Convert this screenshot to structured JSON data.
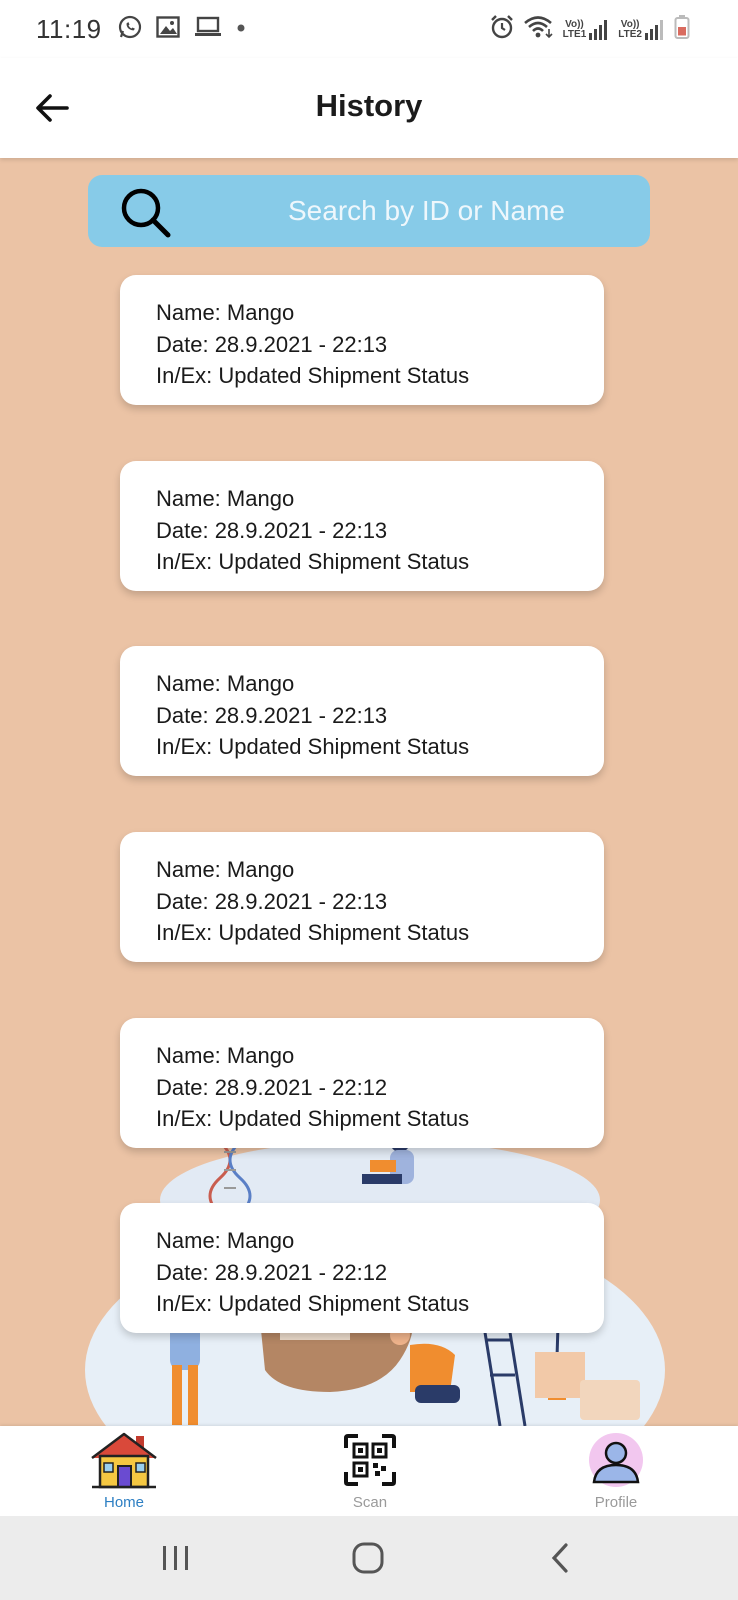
{
  "status_bar": {
    "time": "11:19",
    "left_icons": [
      "whatsapp-icon",
      "gallery-icon",
      "laptop-icon",
      "dot-icon"
    ],
    "right_icons": [
      "alarm-icon",
      "wifi-icon",
      "signal-lte1-icon",
      "signal-lte2-icon",
      "battery-icon"
    ],
    "lte1": "LTE1",
    "lte2": "LTE2",
    "volte": "Vo))"
  },
  "header": {
    "title": "History",
    "back_icon": "arrow-left-icon"
  },
  "search": {
    "placeholder": "Search by ID or Name",
    "value": "",
    "icon": "search-icon"
  },
  "history": [
    {
      "name": "Name: Mango",
      "date": "Date: 28.9.2021 - 22:13",
      "status": "In/Ex: Updated Shipment Status"
    },
    {
      "name": "Name: Mango",
      "date": "Date: 28.9.2021 - 22:13",
      "status": "In/Ex: Updated Shipment Status"
    },
    {
      "name": "Name: Mango",
      "date": "Date: 28.9.2021 - 22:13",
      "status": "In/Ex: Updated Shipment Status"
    },
    {
      "name": "Name: Mango",
      "date": "Date: 28.9.2021 - 22:13",
      "status": "In/Ex: Updated Shipment Status"
    },
    {
      "name": "Name: Mango",
      "date": "Date: 28.9.2021 - 22:12",
      "status": "In/Ex: Updated Shipment Status"
    },
    {
      "name": "Name: Mango",
      "date": "Date: 28.9.2021 - 22:12",
      "status": "In/Ex: Updated Shipment Status"
    }
  ],
  "bottom_nav": {
    "items": [
      {
        "label": "Home",
        "icon": "house-icon",
        "active": true
      },
      {
        "label": "Scan",
        "icon": "qr-code-icon",
        "active": false
      },
      {
        "label": "Profile",
        "icon": "user-avatar-icon",
        "active": false
      }
    ]
  },
  "system_nav": [
    "recent-apps-icon",
    "home-circle-icon",
    "back-chevron-icon"
  ],
  "colors": {
    "background": "#ebc3a5",
    "search_bg": "#87cbe8",
    "active_nav": "#2d7fc3",
    "card_bg": "#ffffff"
  }
}
